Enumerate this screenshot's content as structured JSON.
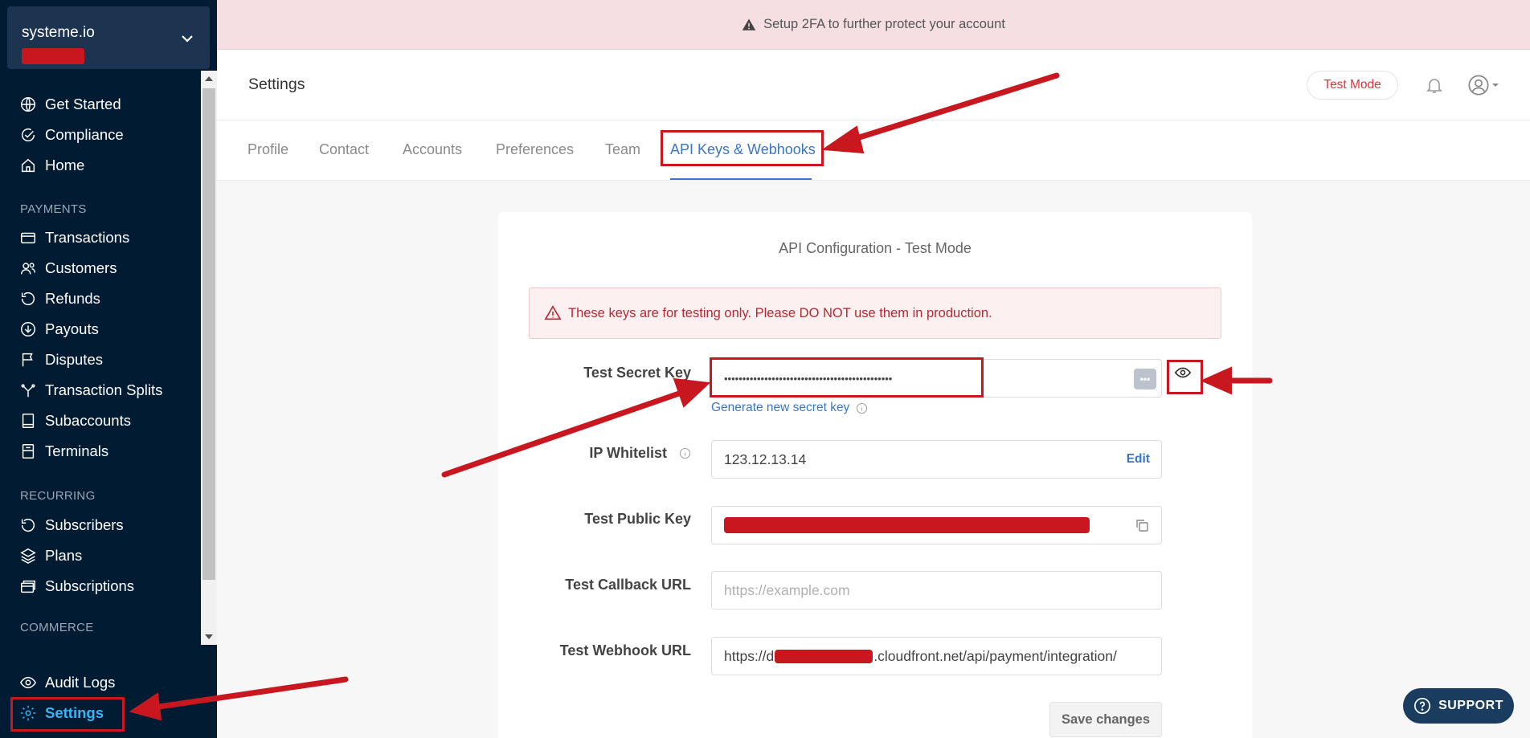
{
  "sidebar": {
    "account_name": "systeme.io",
    "items_main": [
      {
        "label": "Get Started",
        "icon": "globe-icon"
      },
      {
        "label": "Compliance",
        "icon": "check-circle-icon"
      },
      {
        "label": "Home",
        "icon": "home-icon"
      }
    ],
    "payments_section": "PAYMENTS",
    "items_payments": [
      {
        "label": "Transactions",
        "icon": "credit-card-icon"
      },
      {
        "label": "Customers",
        "icon": "users-icon"
      },
      {
        "label": "Refunds",
        "icon": "refund-icon"
      },
      {
        "label": "Payouts",
        "icon": "payout-icon"
      },
      {
        "label": "Disputes",
        "icon": "flag-icon"
      },
      {
        "label": "Transaction Splits",
        "icon": "split-icon"
      },
      {
        "label": "Subaccounts",
        "icon": "book-icon"
      },
      {
        "label": "Terminals",
        "icon": "terminal-icon"
      }
    ],
    "recurring_section": "RECURRING",
    "items_recurring": [
      {
        "label": "Subscribers",
        "icon": "refresh-icon"
      },
      {
        "label": "Plans",
        "icon": "layers-icon"
      },
      {
        "label": "Subscriptions",
        "icon": "cards-icon"
      }
    ],
    "commerce_section": "COMMERCE",
    "audit_logs": "Audit Logs",
    "settings": "Settings"
  },
  "banner": {
    "text": "Setup 2FA to further protect your account"
  },
  "header": {
    "title": "Settings",
    "test_mode": "Test Mode"
  },
  "tabs": [
    "Profile",
    "Contact",
    "Accounts",
    "Preferences",
    "Team",
    "API Keys & Webhooks"
  ],
  "active_tab": "API Keys & Webhooks",
  "api": {
    "title": "API Configuration - Test Mode",
    "warning": "These keys are for testing only. Please DO NOT use them in production.",
    "secret_key_label": "Test Secret Key",
    "secret_key_value": "••••••••••••••••••••••••••••••••••••••••••••••",
    "generate_link": "Generate new secret key",
    "ip_whitelist_label": "IP Whitelist",
    "ip_whitelist_value": "123.12.13.14",
    "edit_label": "Edit",
    "public_key_label": "Test Public Key",
    "callback_label": "Test Callback URL",
    "callback_placeholder": "https://example.com",
    "webhook_label": "Test Webhook URL",
    "webhook_prefix": "https://d",
    "webhook_suffix": ".cloudfront.net/api/payment/integration/",
    "save_label": "Save changes"
  },
  "support_label": "SUPPORT",
  "colors": {
    "sidebar_bg": "#011b33",
    "accent_blue": "#3a76c4",
    "danger": "#e0323f",
    "annotation_red": "#c8171f"
  }
}
